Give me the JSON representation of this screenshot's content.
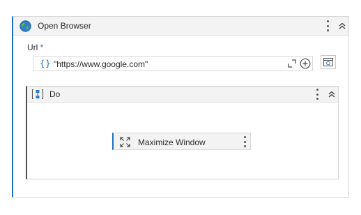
{
  "activity": {
    "title": "Open Browser",
    "icon": "globe-icon",
    "url_label": "Url",
    "required_mark": "*",
    "url_value": "\"https://www.google.com\"",
    "expression_marker": "{}"
  },
  "do_container": {
    "title": "Do",
    "icon": "sequence-icon",
    "child": {
      "title": "Maximize Window",
      "icon": "maximize-icon"
    }
  },
  "colors": {
    "accent": "#1f6fbf",
    "header_bg": "#f3f3f3",
    "border": "#d6d6d6"
  }
}
